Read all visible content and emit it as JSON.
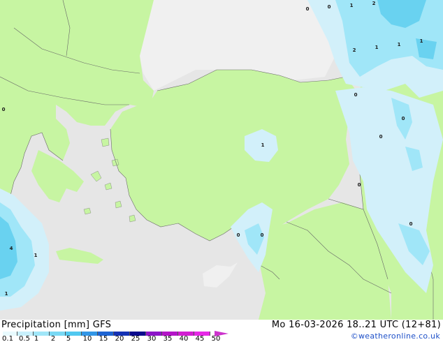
{
  "map": {
    "precip_labels": [
      {
        "id": "p1",
        "text": "0"
      },
      {
        "id": "p2",
        "text": "0"
      },
      {
        "id": "p3",
        "text": "1"
      },
      {
        "id": "p4",
        "text": "2"
      },
      {
        "id": "p5",
        "text": "2"
      },
      {
        "id": "p6",
        "text": "1"
      },
      {
        "id": "p7",
        "text": "1"
      },
      {
        "id": "p8",
        "text": "1"
      },
      {
        "id": "p9",
        "text": "0"
      },
      {
        "id": "p10",
        "text": "0"
      },
      {
        "id": "p11",
        "text": "0"
      },
      {
        "id": "p12",
        "text": "0"
      },
      {
        "id": "p13",
        "text": "0"
      },
      {
        "id": "p14",
        "text": "1"
      },
      {
        "id": "p15",
        "text": "0"
      },
      {
        "id": "p16",
        "text": "0"
      },
      {
        "id": "p17",
        "text": "0"
      },
      {
        "id": "p18",
        "text": "4"
      },
      {
        "id": "p19",
        "text": "1"
      },
      {
        "id": "p20",
        "text": "1"
      }
    ],
    "colors": {
      "land": "#c7f5a2",
      "outside_land": "#f0f0f0",
      "sea": "#e6e6e6",
      "precip_light": "#d2f0fa",
      "precip_mid": "#a0e6f8",
      "precip_heavy": "#69d2f0"
    }
  },
  "footer": {
    "title": "Precipitation [mm]  GFS",
    "valid": "Mo 16-03-2026 18..21 UTC (12+81)",
    "credit": "©weatheronline.co.uk"
  },
  "legend": {
    "ticks": [
      "0.1",
      "0.5",
      "1",
      "2",
      "5",
      "10",
      "15",
      "20",
      "25",
      "30",
      "35",
      "40",
      "45",
      "50"
    ],
    "colors": [
      "#e8fafe",
      "#c8f0fc",
      "#a0e6f8",
      "#78d8f4",
      "#50c8f0",
      "#3296e6",
      "#1e64d2",
      "#1432b4",
      "#0a0a8c",
      "#8c14c8",
      "#b414c8",
      "#d21ed2",
      "#e628e6",
      "#c832c8"
    ]
  }
}
